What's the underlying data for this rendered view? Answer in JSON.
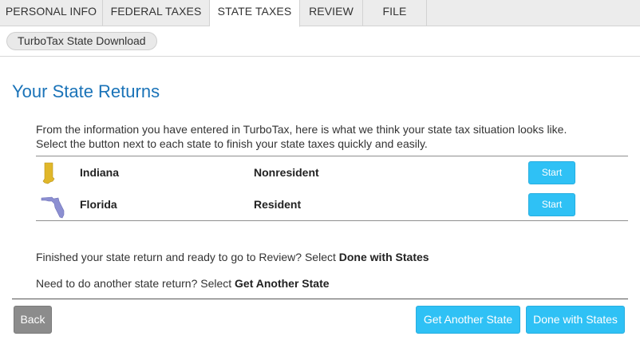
{
  "tabs": [
    {
      "label": "PERSONAL INFO",
      "active": false
    },
    {
      "label": "FEDERAL TAXES",
      "active": false
    },
    {
      "label": "STATE TAXES",
      "active": true
    },
    {
      "label": "REVIEW",
      "active": false
    },
    {
      "label": "FILE",
      "active": false
    }
  ],
  "subnav": {
    "pill_label": "TurboTax State Download"
  },
  "page": {
    "title": "Your State Returns",
    "intro_line1": "From the information you have entered in TurboTax, here is what we think your state tax situation looks like.",
    "intro_line2": "Select the button next to each state to finish your state taxes quickly and easily."
  },
  "states": [
    {
      "name": "Indiana",
      "status": "Nonresident",
      "button": "Start",
      "map_icon": "indiana-map-icon",
      "map_color": "#e0b72a"
    },
    {
      "name": "Florida",
      "status": "Resident",
      "button": "Start",
      "map_icon": "florida-map-icon",
      "map_color": "#8c8fd1"
    }
  ],
  "notes": {
    "done_prefix": "Finished your state return and ready to go to Review? Select ",
    "done_bold": "Done with States",
    "another_prefix": "Need to do another state return? Select ",
    "another_bold": "Get Another State"
  },
  "footer": {
    "back_label": "Back",
    "another_label": "Get Another State",
    "done_label": "Done with States"
  },
  "colors": {
    "accent": "#2fc1f5",
    "title": "#1a73b8",
    "back_button": "#8c8c8c"
  }
}
